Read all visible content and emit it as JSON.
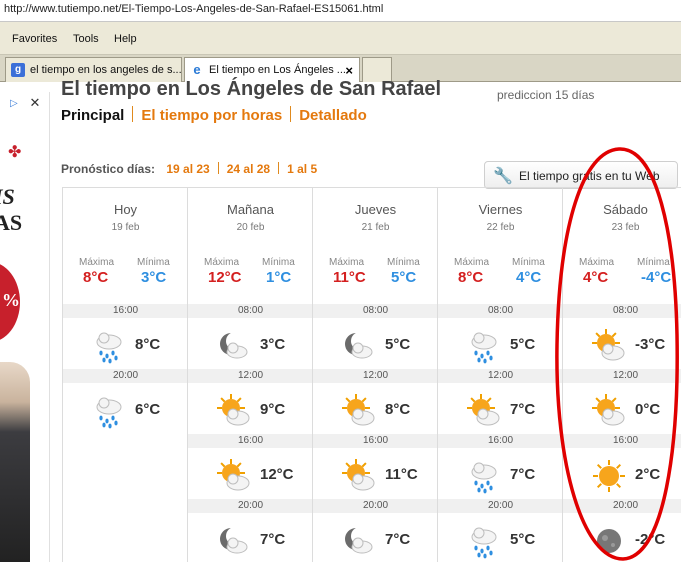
{
  "browser": {
    "url": "http://www.tutiempo.net/El-Tiempo-Los-Angeles-de-San-Rafael-ES15061.html",
    "menu": [
      "Favorites",
      "Tools",
      "Help"
    ],
    "tabs": [
      {
        "label": "el tiempo en los angeles de s..."
      },
      {
        "label": "El tiempo en Los Ángeles ..."
      }
    ]
  },
  "page": {
    "title": "El tiempo en Los Ángeles de San Rafael",
    "subtitle": "prediccion 15 días",
    "nav": [
      "Principal",
      "El tiempo por horas",
      "Detallado"
    ],
    "days_label": "Pronóstico días:",
    "day_ranges": [
      "19 al 23",
      "24 al 28",
      "1 al 5"
    ],
    "widget_button": "El tiempo gratis en tu Web"
  },
  "forecast": {
    "max_label": "Máxima",
    "min_label": "Mínima",
    "days": [
      {
        "name": "Hoy",
        "date": "19 feb",
        "max": "8°C",
        "min": "3°C",
        "slots": [
          {
            "hour": "16:00",
            "icon": "rain-cloud-icon",
            "temp": "8°C"
          },
          {
            "hour": "20:00",
            "icon": "rain-cloud-icon",
            "temp": "6°C"
          }
        ]
      },
      {
        "name": "Mañana",
        "date": "20 feb",
        "max": "12°C",
        "min": "1°C",
        "slots": [
          {
            "hour": "08:00",
            "icon": "moon-cloud-icon",
            "temp": "3°C"
          },
          {
            "hour": "12:00",
            "icon": "sun-cloud-icon",
            "temp": "9°C"
          },
          {
            "hour": "16:00",
            "icon": "sun-cloud-icon",
            "temp": "12°C"
          },
          {
            "hour": "20:00",
            "icon": "moon-cloud-icon",
            "temp": "7°C"
          }
        ]
      },
      {
        "name": "Jueves",
        "date": "21 feb",
        "max": "11°C",
        "min": "5°C",
        "slots": [
          {
            "hour": "08:00",
            "icon": "moon-cloud-icon",
            "temp": "5°C"
          },
          {
            "hour": "12:00",
            "icon": "sun-cloud-icon",
            "temp": "8°C"
          },
          {
            "hour": "16:00",
            "icon": "sun-cloud-icon",
            "temp": "11°C"
          },
          {
            "hour": "20:00",
            "icon": "moon-cloud-icon",
            "temp": "7°C"
          }
        ]
      },
      {
        "name": "Viernes",
        "date": "22 feb",
        "max": "8°C",
        "min": "4°C",
        "slots": [
          {
            "hour": "08:00",
            "icon": "rain-cloud-icon",
            "temp": "5°C"
          },
          {
            "hour": "12:00",
            "icon": "sun-cloud-icon",
            "temp": "7°C"
          },
          {
            "hour": "16:00",
            "icon": "rain-cloud-icon",
            "temp": "7°C"
          },
          {
            "hour": "20:00",
            "icon": "rain-cloud-icon",
            "temp": "5°C"
          }
        ]
      },
      {
        "name": "Sábado",
        "date": "23 feb",
        "max": "4°C",
        "min": "-4°C",
        "slots": [
          {
            "hour": "08:00",
            "icon": "sun-cloud-icon",
            "temp": "-3°C"
          },
          {
            "hour": "12:00",
            "icon": "sun-cloud-icon",
            "temp": "0°C"
          },
          {
            "hour": "16:00",
            "icon": "sun-icon",
            "temp": "2°C"
          },
          {
            "hour": "20:00",
            "icon": "moon-icon",
            "temp": "-2°C"
          }
        ]
      }
    ]
  },
  "colors": {
    "orange": "#e4790e",
    "max_red": "#d42020",
    "min_blue": "#2f8fe0",
    "annotation": "#e00000"
  }
}
